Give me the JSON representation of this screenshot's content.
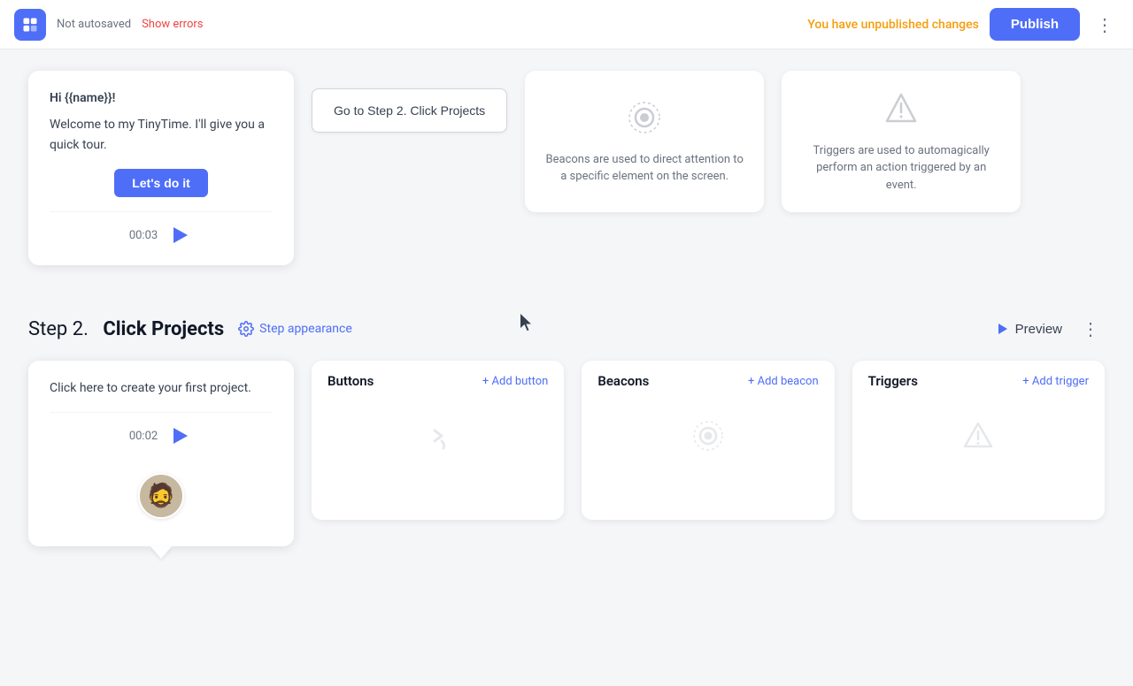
{
  "topbar": {
    "autosave_text": "Not autosaved",
    "show_errors_label": "Show errors",
    "unpublished_text": "You have unpublished changes",
    "publish_label": "Publish",
    "more_icon": "⋮"
  },
  "step1": {
    "tooltip": {
      "line1": "Hi {{name}}!",
      "line2": "Welcome to my TinyTime. I'll give you a quick tour.",
      "cta_label": "Let's do it",
      "timer": "00:03"
    },
    "button": {
      "label": "Go to Step 2. Click Projects"
    },
    "beacon": {
      "description": "Beacons are used to direct attention to a specific element on the screen."
    },
    "trigger": {
      "description": "Triggers are used to automagically perform an action triggered by an event."
    }
  },
  "step2": {
    "number": "Step 2.",
    "name": "Click Projects",
    "appearance_label": "Step appearance",
    "preview_label": "Preview",
    "more_icon": "⋮",
    "tooltip": {
      "text": "Click here to create your first project.",
      "timer": "00:02"
    },
    "buttons_section": {
      "title": "Buttons",
      "add_label": "+ Add button"
    },
    "beacons_section": {
      "title": "Beacons",
      "add_label": "+ Add beacon"
    },
    "triggers_section": {
      "title": "Triggers",
      "add_label": "+ Add trigger"
    }
  }
}
